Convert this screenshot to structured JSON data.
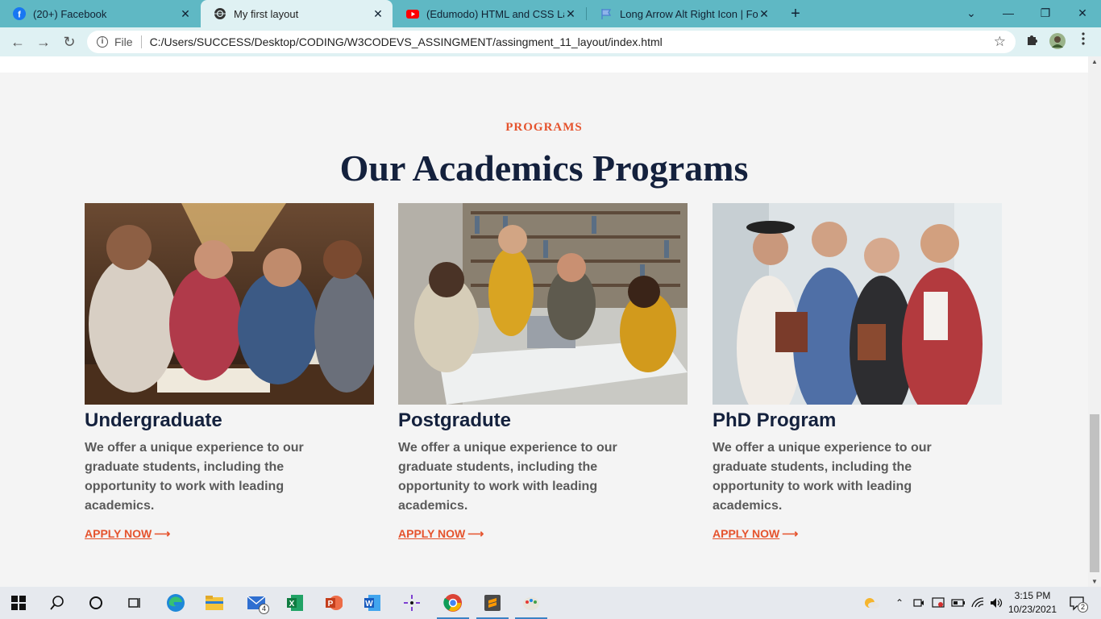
{
  "browser": {
    "tabs": [
      {
        "title": "(20+) Facebook",
        "favicon": "facebook-icon"
      },
      {
        "title": "My first layout",
        "favicon": "globe-icon"
      },
      {
        "title": "(Edumodo) HTML and CSS Layou",
        "favicon": "youtube-icon"
      },
      {
        "title": "Long Arrow Alt Right Icon | Font",
        "favicon": "flag-icon"
      }
    ],
    "new_tab": "+",
    "address": {
      "scheme_label": "File",
      "url": "C:/Users/SUCCESS/Desktop/CODING/W3CODEVS_ASSINGMENT/assingment_11_layout/index.html"
    }
  },
  "page": {
    "eyebrow": "PROGRAMS",
    "heading": "Our Academics Programs",
    "cards": [
      {
        "title": "Undergraduate",
        "text": "We offer a unique experience to our graduate students, including the opportunity to work with leading academics.",
        "link": "APPLY NOW"
      },
      {
        "title": "Postgradute",
        "text": "We offer a unique experience to our graduate students, including the opportunity to work with leading academics.",
        "link": "APPLY NOW"
      },
      {
        "title": "PhD Program",
        "text": "We offer a unique experience to our graduate students, including the opportunity to work with leading academics.",
        "link": "APPLY NOW"
      }
    ]
  },
  "taskbar": {
    "mail_badge": "4",
    "notification_badge": "2",
    "time": "3:15 PM",
    "date": "10/23/2021"
  },
  "colors": {
    "accent": "#e5532d",
    "heading": "#14213d",
    "body_text": "#5a5a5a",
    "tabbar": "#5fb8c4",
    "toolbar": "#dff1f3"
  }
}
